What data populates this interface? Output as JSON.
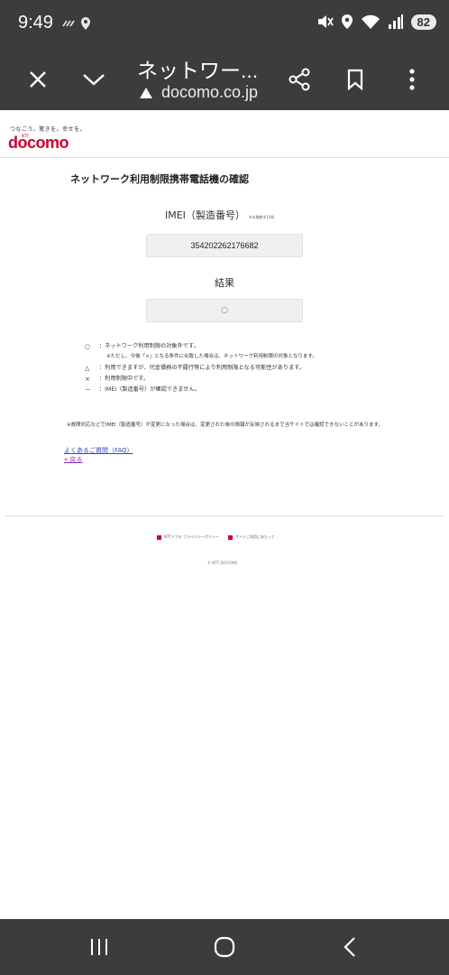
{
  "status_bar": {
    "time": "9:49",
    "left_icons": "⁙",
    "battery": "82"
  },
  "toolbar": {
    "title": "ネットワー...",
    "url": "docomo.co.jp"
  },
  "page": {
    "tagline": "つなごう。驚きを。幸せを。",
    "ntt_label": "NTT",
    "logo": "docomo",
    "title": "ネットワーク利用制限携帯電話機の確認",
    "imei_label": "IMEI（製造番号）",
    "imei_note": "※半角数字15桁",
    "imei_value": "354202262176682",
    "result_label": "結果",
    "result_value": "○",
    "legend": [
      {
        "symbol": "○",
        "text": "：ネットワーク利用制限の対象外です。"
      },
      {
        "symbol": "",
        "text": "※ただし、今後「×」となる条件に合致した場合は、ネットワーク利用制限の対象となります。"
      },
      {
        "symbol": "△",
        "text": "：利用できますが、代金債務の不履行等により利用制限となる可能性があります。"
      },
      {
        "symbol": "×",
        "text": "：利用制限中です。"
      },
      {
        "symbol": "－",
        "text": "：IMEI（製造番号）が確認できません。"
      }
    ],
    "footnote": "※故障対応などでIMEI（製造番号）が変更になった場合は、変更された後の情報が反映されるまで当サイトでは確認できないことがあります。",
    "faq_link": "よくあるご質問（FAQ）",
    "back_link": "« 戻る",
    "footer_links": [
      "NTTドコモ プライバシーポリシー",
      "サイトご利用にあたって"
    ],
    "copyright": "© NTT DOCOMO"
  },
  "colors": {
    "brand": "#cc0033",
    "chrome": "#3c3c3c",
    "link": "#2a4db0",
    "visited_link": "#8a2aa8"
  }
}
